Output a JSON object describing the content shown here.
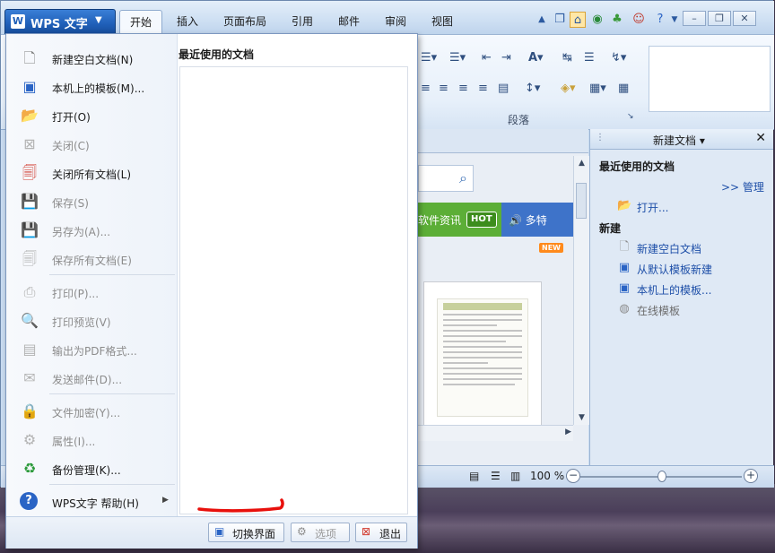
{
  "app_button": {
    "logo": "W",
    "label": "WPS 文字",
    "arrow": "▼"
  },
  "ribbon_tabs": [
    "开始",
    "插入",
    "页面布局",
    "引用",
    "邮件",
    "审阅",
    "视图"
  ],
  "ribbon": {
    "group_paragraph": "段落"
  },
  "app_menu": {
    "items": [
      {
        "label": "新建空白文档(N)",
        "icon": "blank-document-icon",
        "enabled": true
      },
      {
        "label": "本机上的模板(M)...",
        "icon": "template-icon",
        "enabled": true
      },
      {
        "label": "打开(O)",
        "icon": "open-folder-icon",
        "enabled": true
      },
      {
        "label": "关闭(C)",
        "icon": "close-document-icon",
        "enabled": false
      },
      {
        "label": "关闭所有文档(L)",
        "icon": "close-all-icon",
        "enabled": true
      },
      {
        "label": "保存(S)",
        "icon": "save-icon",
        "enabled": false
      },
      {
        "label": "另存为(A)...",
        "icon": "save-as-icon",
        "enabled": false
      },
      {
        "label": "保存所有文档(E)",
        "icon": "save-all-icon",
        "enabled": false
      },
      {
        "label": "打印(P)...",
        "icon": "print-icon",
        "enabled": false
      },
      {
        "label": "打印预览(V)",
        "icon": "print-preview-icon",
        "enabled": false
      },
      {
        "label": "输出为PDF格式...",
        "icon": "pdf-icon",
        "enabled": false
      },
      {
        "label": "发送邮件(D)...",
        "icon": "mail-icon",
        "enabled": false
      },
      {
        "label": "文件加密(Y)...",
        "icon": "lock-icon",
        "enabled": false
      },
      {
        "label": "属性(I)...",
        "icon": "properties-icon",
        "enabled": false
      },
      {
        "label": "备份管理(K)...",
        "icon": "backup-icon",
        "enabled": true
      },
      {
        "label": "WPS文字 帮助(H)",
        "icon": "help-icon",
        "enabled": true
      }
    ],
    "recent_title": "最近使用的文档",
    "footer": {
      "switch_ui": "切换界面",
      "options": "选项",
      "exit": "退出"
    }
  },
  "doc_area": {
    "banner_text": "软件资讯",
    "hot_badge": "HOT",
    "blue_banner_text": "多特",
    "new_badge": "NEW"
  },
  "status_bar": {
    "zoom": "100 %"
  },
  "task_pane": {
    "title": "新建文档",
    "recent_section": "最近使用的文档",
    "manage_link": ">> 管理",
    "open_link": "打开...",
    "new_section": "新建",
    "new_links": [
      {
        "label": "新建空白文档",
        "icon": "blank-document-icon",
        "enabled": true
      },
      {
        "label": "从默认模板新建",
        "icon": "default-template-icon",
        "enabled": true
      },
      {
        "label": "本机上的模板...",
        "icon": "template-icon",
        "enabled": true
      },
      {
        "label": "在线模板",
        "icon": "online-template-icon",
        "enabled": false
      }
    ]
  },
  "colors": {
    "accent_blue": "#1f5fb8",
    "banner_green": "#5cae37",
    "banner_blue": "#3e73c9",
    "annotation_red": "#e8100c"
  }
}
